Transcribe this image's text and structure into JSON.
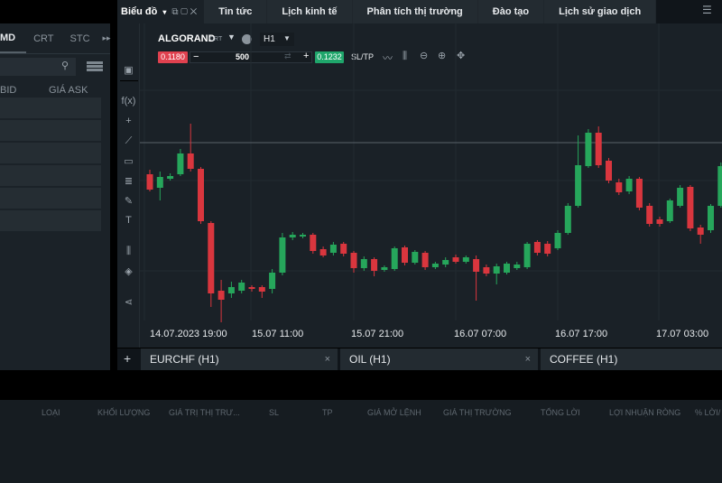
{
  "market_panel": {
    "tabs": [
      "MD",
      "CRT",
      "STC"
    ],
    "more_icon": "double-chevron-right",
    "search_icon": "search-icon",
    "layout_icon": "grid-icon",
    "columns": [
      "BID",
      "GIÁ ASK"
    ]
  },
  "top_tabs": {
    "chart_label": "Biểu đồ",
    "items": [
      "Tin tức",
      "Lịch kinh tế",
      "Phân tích thị trường",
      "Đào tạo",
      "Lịch sử giao dịch"
    ]
  },
  "chart": {
    "symbol": "ALGORAND",
    "symbol_type": "CRT",
    "timeframe": "H1",
    "sell_price": "0.1180",
    "buy_price": "0.1232",
    "volume": "500",
    "sltp_label": "SL/TP",
    "minus": "−",
    "plus": "+",
    "sell_color": "#e0414f",
    "buy_color": "#1fa66b"
  },
  "chart_data": {
    "type": "candlestick",
    "x_ticks": [
      "14.07.2023 19:00",
      "15.07 11:00",
      "15.07 21:00",
      "16.07 07:00",
      "16.07 17:00",
      "17.07 03:00"
    ],
    "up_color": "#26a65b",
    "down_color": "#d9363e",
    "reference_line": 0.118,
    "candles": [
      [
        0.1145,
        0.1128,
        0.115,
        0.1126
      ],
      [
        0.113,
        0.1142,
        0.1148,
        0.1116
      ],
      [
        0.114,
        0.1143,
        0.1146,
        0.1138
      ],
      [
        0.1145,
        0.1168,
        0.1173,
        0.1143
      ],
      [
        0.1168,
        0.1151,
        0.1201,
        0.1148
      ],
      [
        0.1151,
        0.1093,
        0.1153,
        0.109
      ],
      [
        0.1091,
        0.1013,
        0.1093,
        0.0998
      ],
      [
        0.1016,
        0.1006,
        0.1028,
        0.0981
      ],
      [
        0.1013,
        0.102,
        0.1026,
        0.1008
      ],
      [
        0.1016,
        0.1025,
        0.1028,
        0.1013
      ],
      [
        0.102,
        0.1018,
        0.1022,
        0.1015
      ],
      [
        0.102,
        0.1015,
        0.1022,
        0.1008
      ],
      [
        0.1018,
        0.1036,
        0.104,
        0.1013
      ],
      [
        0.1036,
        0.1075,
        0.108,
        0.1033
      ],
      [
        0.1075,
        0.1078,
        0.1081,
        0.1072
      ],
      [
        0.1076,
        0.1078,
        0.108,
        0.1074
      ],
      [
        0.1078,
        0.106,
        0.108,
        0.1057
      ],
      [
        0.1062,
        0.1055,
        0.1065,
        0.1053
      ],
      [
        0.1058,
        0.1067,
        0.107,
        0.1055
      ],
      [
        0.1068,
        0.1057,
        0.107,
        0.1054
      ],
      [
        0.1058,
        0.1041,
        0.106,
        0.1036
      ],
      [
        0.1041,
        0.1051,
        0.1054,
        0.1038
      ],
      [
        0.1051,
        0.1038,
        0.1053,
        0.1032
      ],
      [
        0.1039,
        0.1042,
        0.1044,
        0.1037
      ],
      [
        0.104,
        0.1063,
        0.1065,
        0.1038
      ],
      [
        0.1064,
        0.1047,
        0.1066,
        0.1044
      ],
      [
        0.1047,
        0.1059,
        0.1061,
        0.1045
      ],
      [
        0.1058,
        0.1042,
        0.106,
        0.1039
      ],
      [
        0.1042,
        0.1046,
        0.1048,
        0.104
      ],
      [
        0.1045,
        0.105,
        0.1053,
        0.1042
      ],
      [
        0.1053,
        0.1048,
        0.1056,
        0.1046
      ],
      [
        0.1048,
        0.1053,
        0.1055,
        0.1046
      ],
      [
        0.1051,
        0.1037,
        0.1055,
        0.1005
      ],
      [
        0.1042,
        0.1035,
        0.1045,
        0.1032
      ],
      [
        0.1035,
        0.1043,
        0.1046,
        0.1023
      ],
      [
        0.1036,
        0.1046,
        0.1048,
        0.1034
      ],
      [
        0.1041,
        0.1045,
        0.1048,
        0.1039
      ],
      [
        0.1042,
        0.1068,
        0.107,
        0.104
      ],
      [
        0.107,
        0.1058,
        0.1072,
        0.1055
      ],
      [
        0.1068,
        0.1057,
        0.1071,
        0.1054
      ],
      [
        0.1063,
        0.108,
        0.1083,
        0.1061
      ],
      [
        0.108,
        0.111,
        0.1113,
        0.1078
      ],
      [
        0.111,
        0.1155,
        0.1188,
        0.1108
      ],
      [
        0.1154,
        0.1191,
        0.1195,
        0.1152
      ],
      [
        0.1191,
        0.1155,
        0.1198,
        0.1152
      ],
      [
        0.116,
        0.1138,
        0.1163,
        0.1135
      ],
      [
        0.1136,
        0.1125,
        0.114,
        0.1122
      ],
      [
        0.1126,
        0.114,
        0.1143,
        0.1123
      ],
      [
        0.114,
        0.1108,
        0.1142,
        0.1105
      ],
      [
        0.111,
        0.109,
        0.1113,
        0.1087
      ],
      [
        0.1095,
        0.109,
        0.1098,
        0.1087
      ],
      [
        0.1093,
        0.1116,
        0.1118,
        0.1091
      ],
      [
        0.111,
        0.113,
        0.1133,
        0.1108
      ],
      [
        0.1131,
        0.1085,
        0.1133,
        0.1082
      ],
      [
        0.1086,
        0.1078,
        0.1089,
        0.1068
      ],
      [
        0.1083,
        0.111,
        0.1112,
        0.108
      ],
      [
        0.111,
        0.1154,
        0.1158,
        0.1108
      ]
    ]
  },
  "bottom_tabs": {
    "add": "+",
    "items": [
      "EURCHF (H1)",
      "OIL (H1)",
      "COFFEE (H1)"
    ],
    "close": "×"
  },
  "positions_table": {
    "columns": [
      "LOẠI",
      "KHỐI LƯỢNG",
      "GIÁ TRỊ THỊ TRƯ...",
      "SL",
      "TP",
      "GIÁ MỞ LỆNH",
      "GIÁ THỊ TRƯỜNG",
      "TỔNG LỜI",
      "LỢI NHUẬN RÒNG",
      "% LỜI/"
    ]
  }
}
